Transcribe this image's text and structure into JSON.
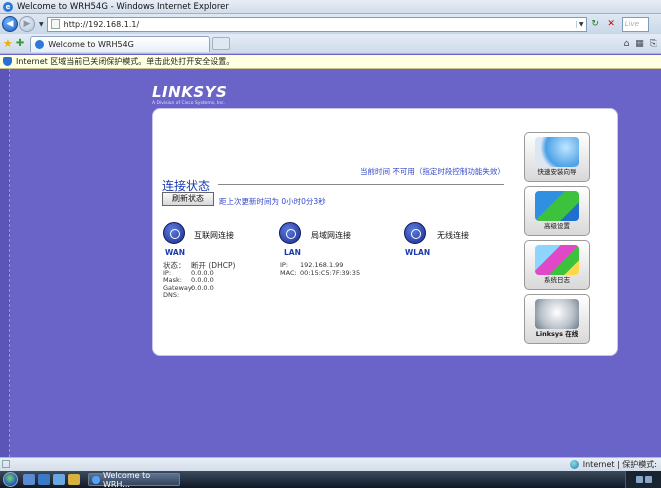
{
  "window": {
    "title": "Welcome to WRH54G - Windows Internet Explorer"
  },
  "address_bar": {
    "url": "http://192.168.1.1/",
    "search_placeholder": "Live Se"
  },
  "tabs": [
    {
      "label": "Welcome to WRH54G"
    }
  ],
  "infobar": {
    "text": "Internet 区域当前已关闭保护模式。单击此处打开安全设置。"
  },
  "router": {
    "logo": "LINKSYS",
    "logo_sub": "A Division of Cisco Systems, Inc.",
    "hint": "当前时间 不可用（指定时段控制功能失效）",
    "section_title": "连接状态",
    "refresh_button": "刷新状态",
    "last_update": "距上次更新时间为 0小时0分3秒",
    "wan": {
      "label": "互联网连接",
      "tag": "WAN",
      "status_key": "状态：",
      "status_value": "断开  (DHCP)",
      "rows": [
        {
          "k": "IP:",
          "v": "0.0.0.0"
        },
        {
          "k": "Mask:",
          "v": "0.0.0.0"
        },
        {
          "k": "Gateway:",
          "v": "0.0.0.0"
        },
        {
          "k": "DNS:",
          "v": ""
        }
      ]
    },
    "lan": {
      "label": "局域网连接",
      "tag": "LAN",
      "rows": [
        {
          "k": "IP:",
          "v": "192.168.1.99"
        },
        {
          "k": "MAC:",
          "v": "00:15:C5:7F:39:35"
        }
      ]
    },
    "wlan": {
      "label": "无线连接",
      "tag": "WLAN"
    },
    "side_buttons": [
      {
        "label": "快速安装向导",
        "icon": "wand-icon"
      },
      {
        "label": "高级设置",
        "icon": "gears-icon"
      },
      {
        "label": "系统日志",
        "icon": "log-icon"
      },
      {
        "label": "Linksys 在线",
        "icon": "globe-clock-icon"
      }
    ]
  },
  "statusbar": {
    "zone": "Internet | 保护模式:"
  },
  "taskbar": {
    "task_label": "Welcome to WRH..."
  }
}
